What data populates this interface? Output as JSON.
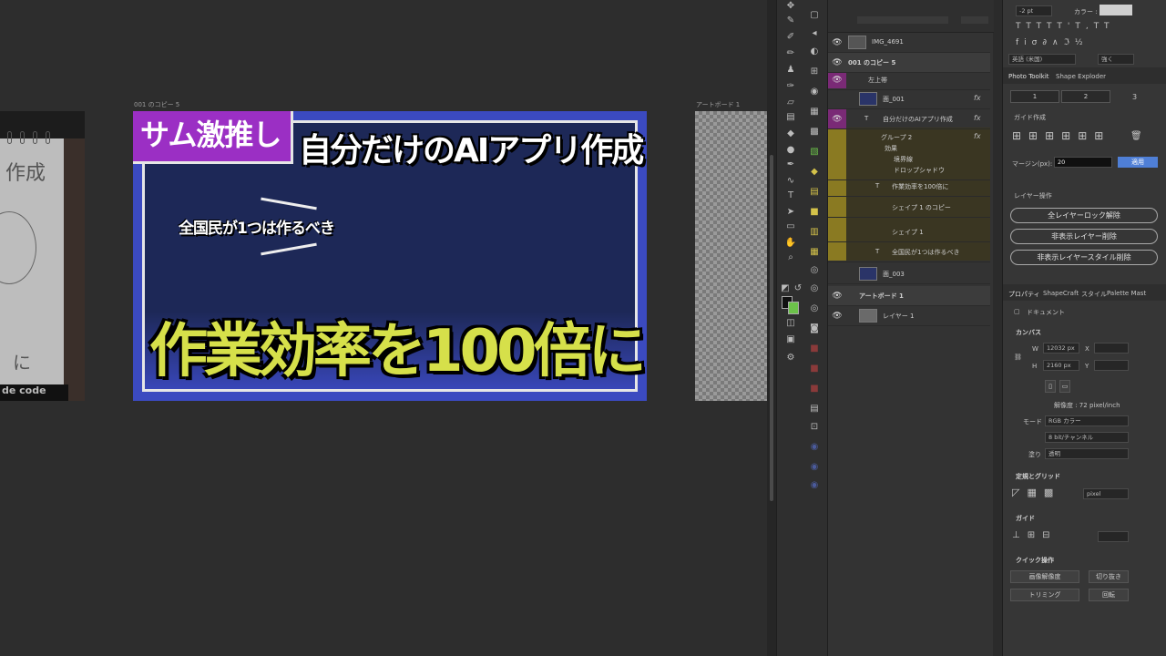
{
  "canvas": {
    "artboard_copy_label": "001 のコピー 5",
    "artboard1_label": "アートボード 1",
    "left_photo": {
      "text1": "作成",
      "text2": "に",
      "code_text": "de code"
    },
    "thumbnail": {
      "tag": "サム激推し",
      "title": "自分だけのAIアプリ作成",
      "sub": "全国民が1つは作るべき",
      "big": "作業効率を100倍に"
    }
  },
  "layers": {
    "rows": [
      {
        "name": "IMG_4691"
      },
      {
        "name": "001 のコピー 5"
      },
      {
        "name": "左上帯"
      },
      {
        "name": "面_001",
        "fx": "fx"
      },
      {
        "name": "自分だけのAIアプリ作成",
        "fx": "fx"
      },
      {
        "name": "グループ 2",
        "fx": "fx"
      },
      {
        "name": "効果"
      },
      {
        "name": "境界線"
      },
      {
        "name": "ドロップシャドウ"
      },
      {
        "name": "作業効率を100倍に"
      },
      {
        "name": "シェイプ 1 のコピー"
      },
      {
        "name": "シェイプ 1"
      },
      {
        "name": "全国民が1つは作るべき"
      },
      {
        "name": "面_003"
      },
      {
        "name": "アートボード 1"
      },
      {
        "name": "レイヤー 1"
      }
    ]
  },
  "props": {
    "size_field": "-2 pt",
    "color_label": "カラー :",
    "language": "英語 (米国)",
    "aa": "強く",
    "tabs": [
      "Photo Toolkit",
      "Shape Exploder"
    ],
    "cols": [
      "1",
      "2",
      "3"
    ],
    "guide_label": "ガイド作成",
    "margin_label": "マージン(px):",
    "margin_value": "20",
    "apply": "適用",
    "layer_ops": "レイヤー操作",
    "btn1": "全レイヤーロック解除",
    "btn2": "非表示レイヤー削除",
    "btn3": "非表示レイヤースタイル削除",
    "prop_tabs": [
      "プロパティ",
      "ShapeCraft",
      "スタイル",
      "Palette Mast"
    ],
    "document": "ドキュメント",
    "canvas_title": "カンバス",
    "w_label": "W",
    "w_value": "12032 px",
    "h_label": "H",
    "h_value": "2160 px",
    "x_label": "X",
    "y_label": "Y",
    "resolution": "解像度 : 72 pixel/inch",
    "mode_label": "モード",
    "mode_value": "RGB カラー",
    "depth_value": "8 bit/チャンネル",
    "fill_label": "塗り",
    "fill_value": "透明",
    "rulers_title": "定規とグリッド",
    "unit_value": "pixel",
    "guides_title": "ガイド",
    "quick_title": "クイック操作",
    "q1": "画像解像度",
    "q2": "切り抜き",
    "q3": "トリミング",
    "q4": "回転"
  },
  "colors": {
    "accent": "#4f7fd6",
    "layer_yellow": "#b39a2a",
    "layer_magenta": "#8c2f86",
    "thumb_blue": "#3b4ac0",
    "thumb_yellow": "#d6e04a"
  }
}
